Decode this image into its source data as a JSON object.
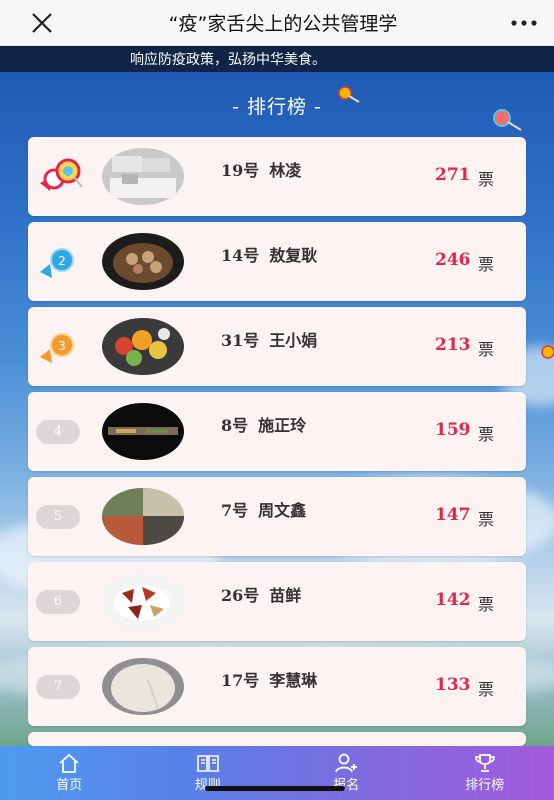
{
  "titlebar": {
    "title": "“疫”家舌尖上的公共管理学",
    "close_icon": "close-icon",
    "more_icon": "more-icon"
  },
  "marquee": {
    "text": "响应防疫政策，弘扬中华美食。"
  },
  "heading": "- 排行榜 -",
  "unit_label": "票",
  "entries": [
    {
      "rank": "1",
      "number": "19号",
      "name": "林凌",
      "votes": "271"
    },
    {
      "rank": "2",
      "number": "14号",
      "name": "敖复耿",
      "votes": "246"
    },
    {
      "rank": "3",
      "number": "31号",
      "name": "王小娟",
      "votes": "213"
    },
    {
      "rank": "4",
      "number": "8号",
      "name": "施正玲",
      "votes": "159"
    },
    {
      "rank": "5",
      "number": "7号",
      "name": "周文鑫",
      "votes": "147"
    },
    {
      "rank": "6",
      "number": "26号",
      "name": "苗鲜",
      "votes": "142"
    },
    {
      "rank": "7",
      "number": "17号",
      "name": "李慧琳",
      "votes": "133"
    }
  ],
  "tabs": [
    {
      "label": "首页",
      "icon": "home-icon"
    },
    {
      "label": "规则",
      "icon": "book-icon"
    },
    {
      "label": "报名",
      "icon": "add-user-icon"
    },
    {
      "label": "排行榜",
      "icon": "trophy-icon"
    }
  ],
  "colors": {
    "accent_votes": "#e0284a",
    "card_bg": "#fdf3f3",
    "marquee_bg": "#0f2546"
  }
}
